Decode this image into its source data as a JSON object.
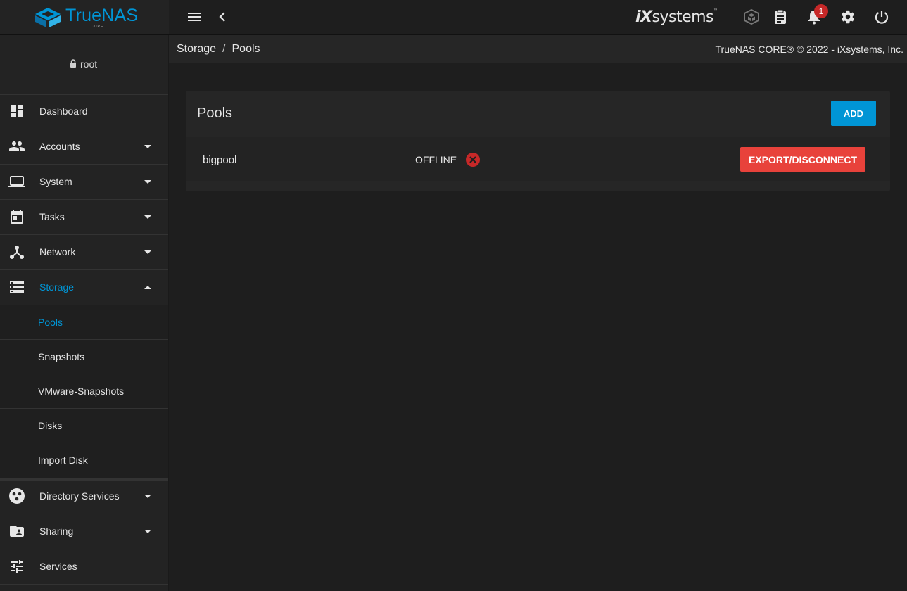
{
  "brand": {
    "name": "TrueNAS",
    "sub": "CORE"
  },
  "topbar": {
    "vendor_name": "systems",
    "vendor_prefix": "iX",
    "notification_count": "1"
  },
  "user": {
    "name": "root"
  },
  "sidebar": {
    "items": [
      {
        "label": "Dashboard",
        "icon": "dashboard-icon"
      },
      {
        "label": "Accounts",
        "icon": "people-icon"
      },
      {
        "label": "System",
        "icon": "laptop-icon"
      },
      {
        "label": "Tasks",
        "icon": "calendar-icon"
      },
      {
        "label": "Network",
        "icon": "network-icon"
      },
      {
        "label": "Storage",
        "icon": "storage-icon"
      },
      {
        "label": "Directory Services",
        "icon": "directory-icon"
      },
      {
        "label": "Sharing",
        "icon": "folder-share-icon"
      },
      {
        "label": "Services",
        "icon": "tune-icon"
      }
    ],
    "storage_sub": [
      "Pools",
      "Snapshots",
      "VMware-Snapshots",
      "Disks",
      "Import Disk"
    ]
  },
  "breadcrumb": {
    "parent": "Storage",
    "sep": "/",
    "current": "Pools"
  },
  "copyright": "TrueNAS CORE® © 2022 - iXsystems, Inc.",
  "card": {
    "title": "Pools",
    "add_label": "ADD",
    "pools": [
      {
        "name": "bigpool",
        "status": "OFFLINE",
        "action": "EXPORT/DISCONNECT"
      }
    ]
  },
  "colors": {
    "accent": "#0095d5",
    "danger": "#e8423b",
    "status_error": "#c62828"
  }
}
